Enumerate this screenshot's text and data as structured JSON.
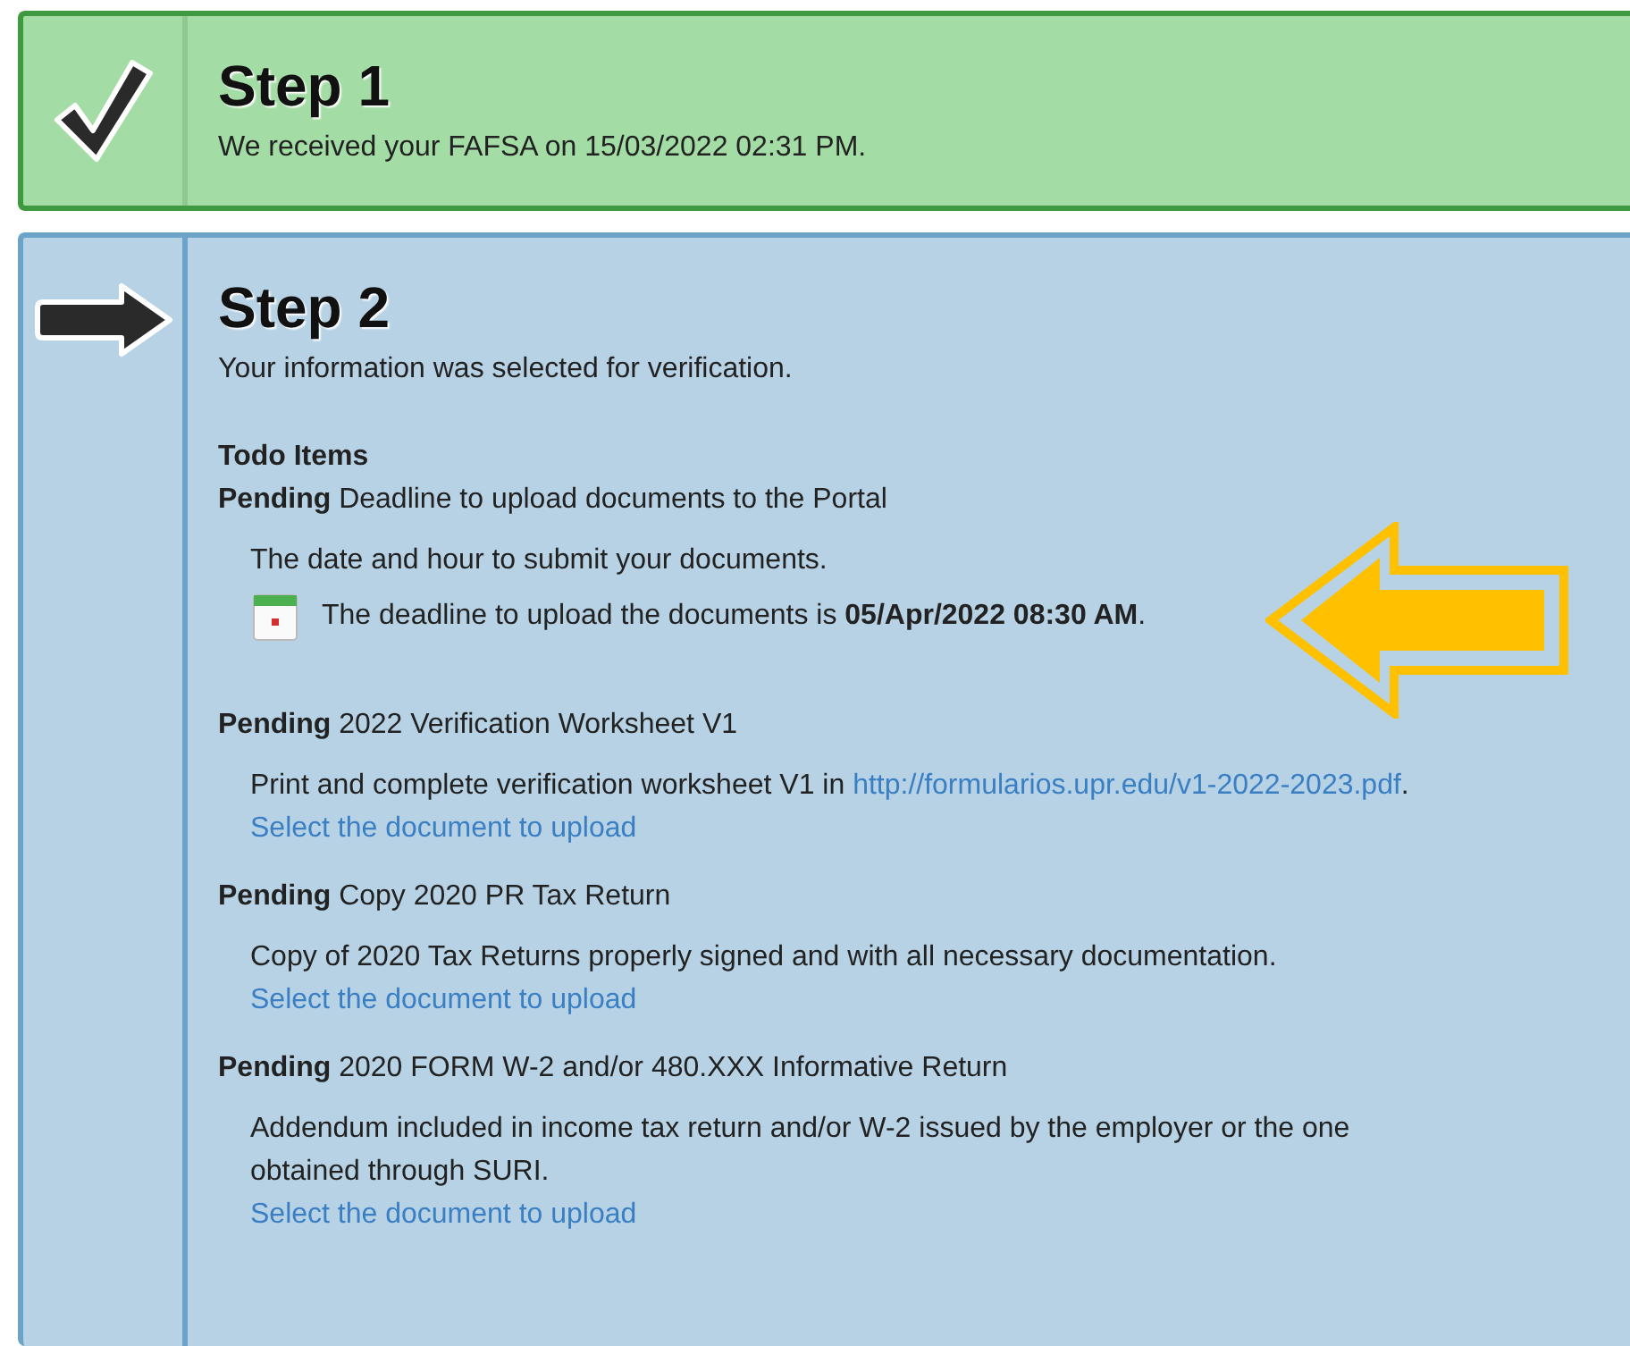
{
  "steps": [
    {
      "kind": "complete",
      "title": "Step 1",
      "description": "We received your FAFSA on 15/03/2022 02:31 PM."
    },
    {
      "kind": "current",
      "title": "Step 2",
      "description": "Your information was selected for verification.",
      "todo_heading": "Todo Items",
      "items": [
        {
          "status": "Pending",
          "title": "Deadline to upload documents to the Portal",
          "description": "The date and hour to submit your documents.",
          "deadline": "The deadline to upload the documents is **05/Apr/2022 08:30 AM**."
        },
        {
          "status": "Pending",
          "title": "2022 Verification Worksheet V1",
          "description": "Print and complete verification worksheet V1 in",
          "link": "http://formularios.upr.edu/v1-2022-2023.pdf",
          "link_after": ".",
          "upload_link": "Select the document to upload"
        },
        {
          "status": "Pending",
          "title": "Copy 2020 PR Tax Return",
          "description": "Copy of 2020 Tax Returns properly signed and with all necessary documentation.",
          "upload_link": "Select the document to upload"
        },
        {
          "status": "Pending",
          "title": "2020 FORM W-2 and/or 480.XXX Informative Return",
          "description": "Addendum included in income tax return and/or W-2 issued by the employer or the one obtained through SURI.",
          "upload_link": "Select the document to upload"
        }
      ]
    }
  ]
}
